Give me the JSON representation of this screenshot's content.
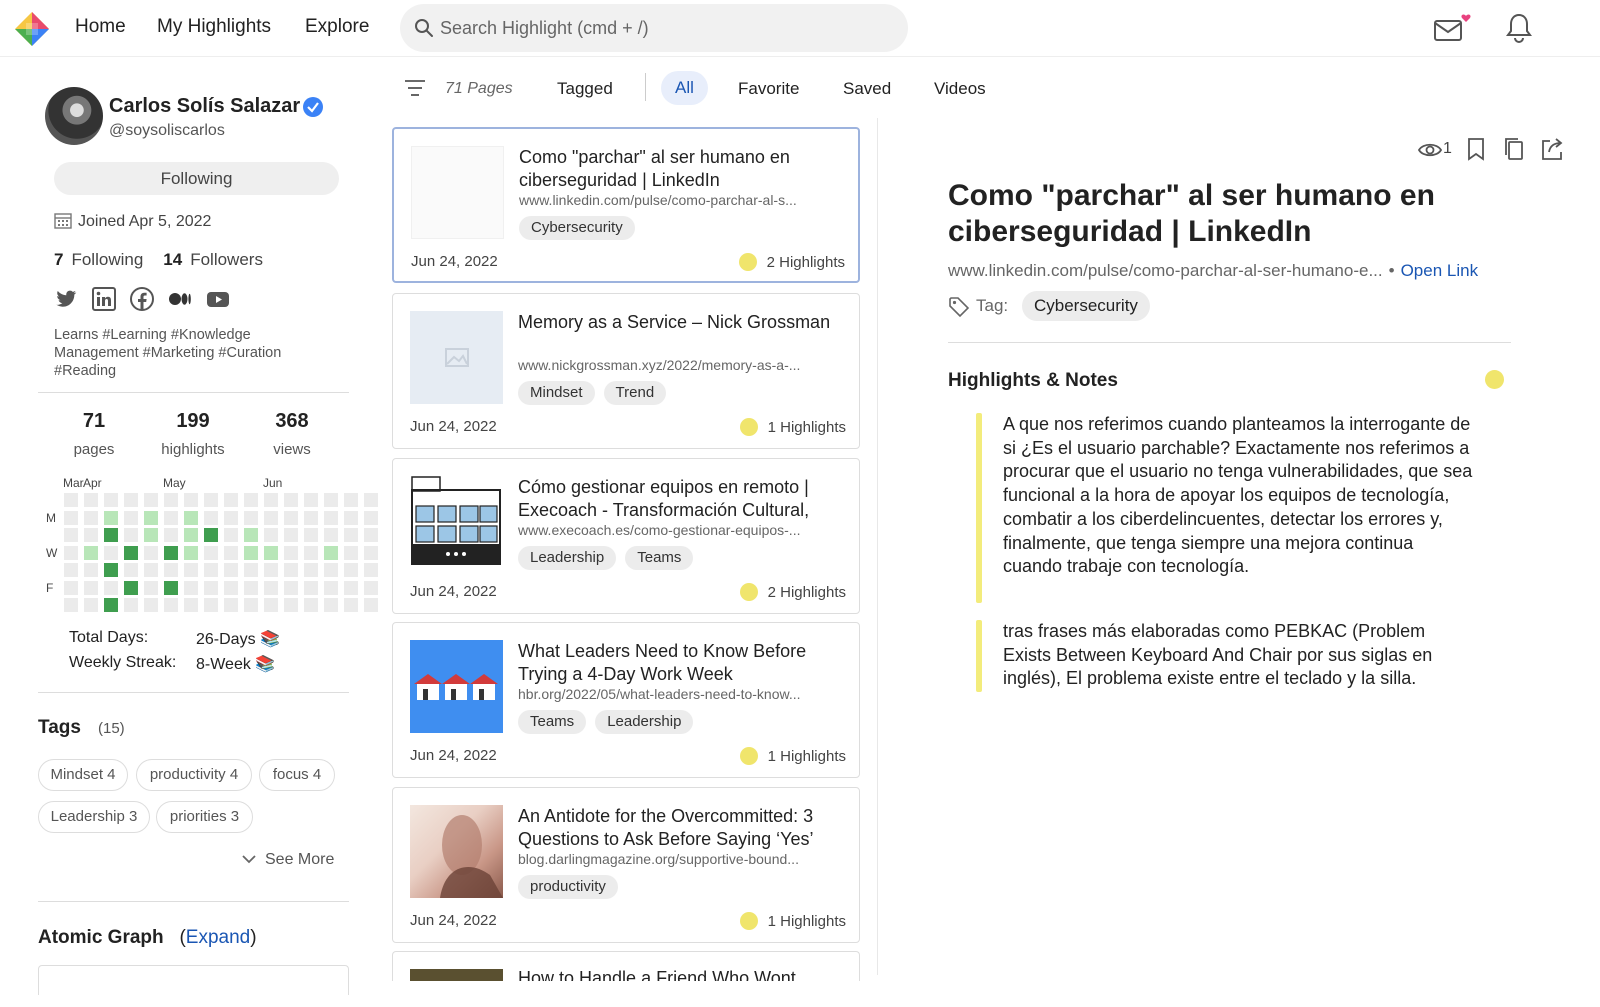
{
  "nav": {
    "links": [
      "Home",
      "My Highlights",
      "Explore"
    ],
    "search_placeholder": "Search Highlight (cmd + /)"
  },
  "profile": {
    "name": "Carlos Solís Salazar",
    "handle": "@soysoliscarlos",
    "follow_label": "Following",
    "joined": "Joined Apr 5, 2022",
    "following_count": "7",
    "following_label": "Following",
    "followers_count": "14",
    "followers_label": "Followers",
    "socials": [
      "twitter-icon",
      "linkedin-icon",
      "facebook-icon",
      "medium-icon",
      "youtube-icon"
    ],
    "bio": "Learns #Learning #Knowledge Management #Marketing #Curation #Reading",
    "stats": [
      {
        "value": "71",
        "label": "pages"
      },
      {
        "value": "199",
        "label": "highlights"
      },
      {
        "value": "368",
        "label": "views"
      }
    ]
  },
  "calendar": {
    "months": [
      "Mar",
      "Apr",
      "May",
      "Jun"
    ],
    "day_labels": [
      "M",
      "W",
      "F"
    ],
    "colors": {
      "empty": "#ebebeb",
      "light": "#b8e6b8",
      "dark": "#3f9e4f"
    },
    "weeks": [
      "0000000",
      "0001000",
      "0120202",
      "0002020",
      "0110000",
      "0002020",
      "0111000",
      "0020000",
      "0000000",
      "0011000",
      "0001000",
      "0000000",
      "0000000",
      "0001000",
      "0000000",
      "0000000"
    ],
    "total_days_label": "Total Days:",
    "total_days_value": "26-Days",
    "weekly_streak_label": "Weekly Streak:",
    "weekly_streak_value": "8-Week"
  },
  "tags": {
    "title": "Tags",
    "count": "(15)",
    "items": [
      "Mindset 4",
      "productivity 4",
      "focus 4",
      "Leadership 3",
      "priorities 3"
    ],
    "see_more": "See More"
  },
  "atomic_graph": {
    "title": "Atomic Graph",
    "expand": "Expand"
  },
  "filters": {
    "pages_count": "71 Pages",
    "tabs": [
      "Tagged",
      "All",
      "Favorite",
      "Saved",
      "Videos"
    ],
    "active": "All"
  },
  "pages": [
    {
      "title": "Como \"parchar\" al ser humano en ciberseguridad | LinkedIn",
      "url": "www.linkedin.com/pulse/como-parchar-al-s...",
      "tags": [
        "Cybersecurity"
      ],
      "date": "Jun 24, 2022",
      "highlights": "2 Highlights",
      "thumb": "blank"
    },
    {
      "title": "Memory as a Service – Nick Grossman",
      "url": "www.nickgrossman.xyz/2022/memory-as-a-...",
      "tags": [
        "Mindset",
        "Trend"
      ],
      "date": "Jun 24, 2022",
      "highlights": "1 Highlights",
      "thumb": "placeholder"
    },
    {
      "title": "Cómo gestionar equipos en remoto | Execoach - Transformación Cultural,",
      "url": "www.execoach.es/como-gestionar-equipos-...",
      "tags": [
        "Leadership",
        "Teams"
      ],
      "date": "Jun 24, 2022",
      "highlights": "2 Highlights",
      "thumb": "sketch"
    },
    {
      "title": "What Leaders Need to Know Before Trying a 4-Day Work Week",
      "url": "hbr.org/2022/05/what-leaders-need-to-know...",
      "tags": [
        "Teams",
        "Leadership"
      ],
      "date": "Jun 24, 2022",
      "highlights": "1 Highlights",
      "thumb": "houses"
    },
    {
      "title": "An Antidote for the Overcommitted: 3 Questions to Ask Before Saying ‘Yes’",
      "url": "blog.darlingmagazine.org/supportive-bound...",
      "tags": [
        "productivity"
      ],
      "date": "Jun 24, 2022",
      "highlights": "1 Highlights",
      "thumb": "photo"
    }
  ],
  "partial_card_title": "How to Handle a Friend Who Wont",
  "detail": {
    "views": "1",
    "title": "Como \"parchar\" al ser humano en ciberseguridad | LinkedIn",
    "url": "www.linkedin.com/pulse/como-parchar-al-ser-humano-e...",
    "open_link": "Open Link",
    "tag_label": "Tag:",
    "tag": "Cybersecurity",
    "hn_title": "Highlights & Notes",
    "highlights": [
      "A que nos referimos cuando planteamos la interrogante de si ¿Es el usuario parchable? Exactamente nos referimos a procurar que el usuario no tenga vulnerabilidades, que sea funcional a la hora de apoyar los equipos de tecnología, combatir a los ciberdelincuentes, detectar los errores y, finalmente, que tenga siempre una mejora continua cuando trabaje con tecnología.",
      "tras frases más elaboradas como PEBKAC (Problem Exists Between Keyboard And Chair por sus siglas en inglés), El problema existe entre el teclado y la silla."
    ],
    "highlight_color": "#f3ec7c"
  }
}
